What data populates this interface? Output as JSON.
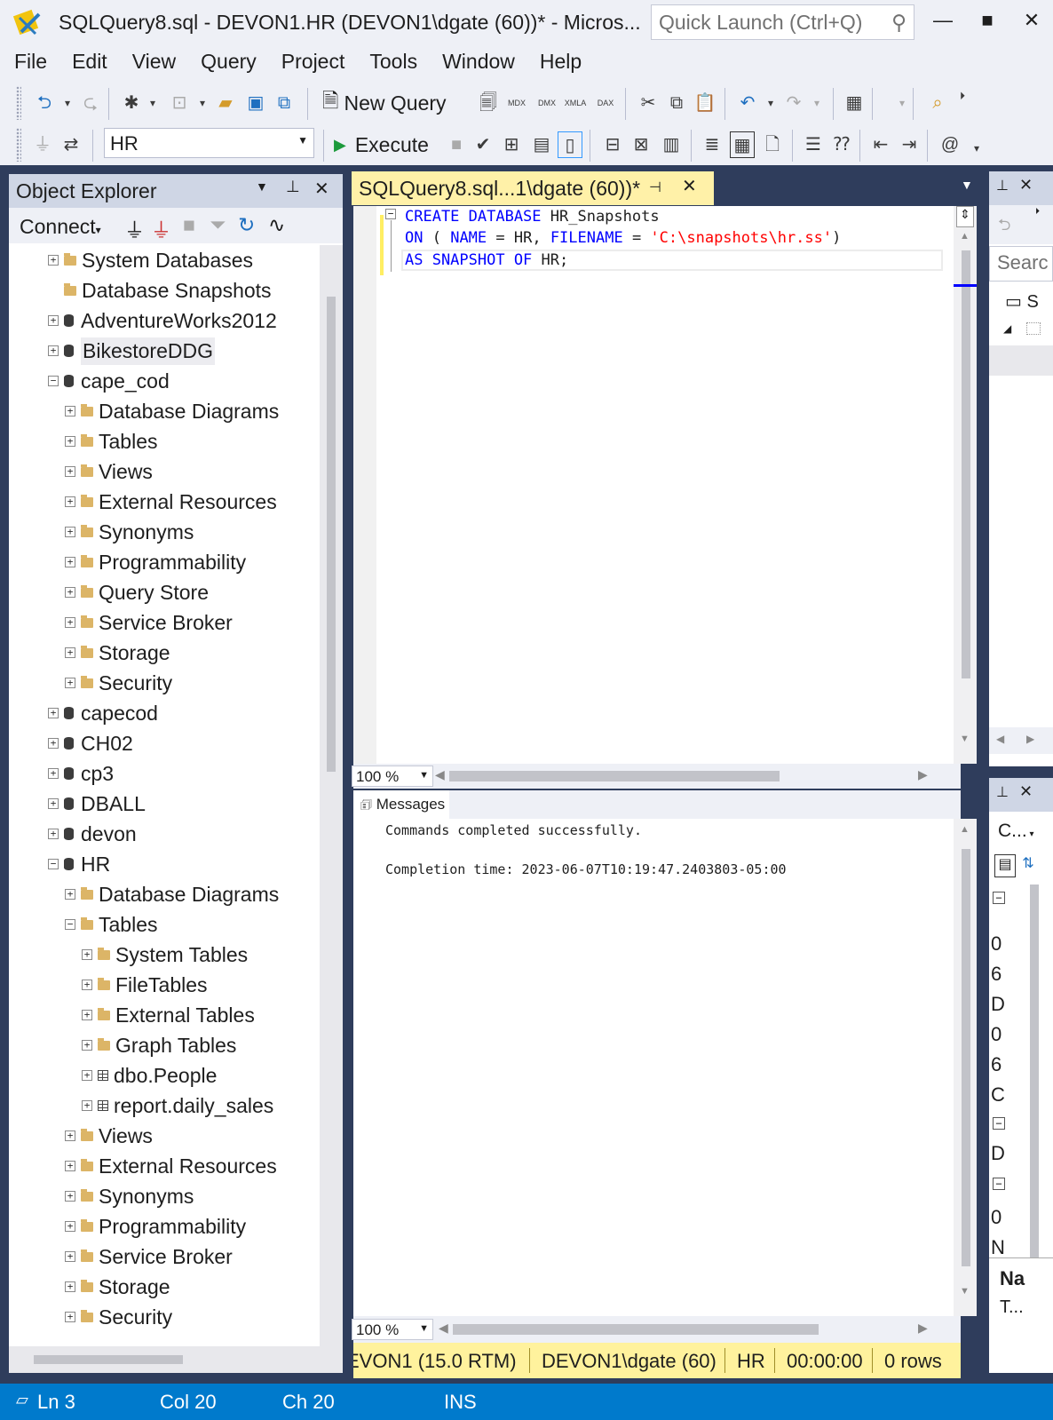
{
  "window": {
    "title": "SQLQuery8.sql - DEVON1.HR (DEVON1\\dgate (60))* - Micros...",
    "quick_launch_placeholder": "Quick Launch (Ctrl+Q)",
    "minimize": "—",
    "maximize": "■",
    "close": "✕"
  },
  "menu": [
    "File",
    "Edit",
    "View",
    "Query",
    "Project",
    "Tools",
    "Window",
    "Help"
  ],
  "toolbar": {
    "new_query": "New Query",
    "database": "HR",
    "execute": "Execute",
    "mdx": "MDX",
    "dmx": "DMX",
    "xmla": "XMLA",
    "dax": "DAX"
  },
  "object_explorer": {
    "title": "Object Explorer",
    "connect": "Connect",
    "tree": [
      {
        "label": "System Databases",
        "expander": "+",
        "icon": "folder-icon",
        "level": 0
      },
      {
        "label": "Database Snapshots",
        "expander": "",
        "icon": "folder-icon",
        "level": 0
      },
      {
        "label": "AdventureWorks2012",
        "expander": "+",
        "icon": "database-icon",
        "level": 0
      },
      {
        "label": "BikestoreDDG",
        "expander": "+",
        "icon": "database-icon",
        "level": 0,
        "hover": true
      },
      {
        "label": "cape_cod",
        "expander": "−",
        "icon": "database-icon",
        "level": 0
      },
      {
        "label": "Database Diagrams",
        "expander": "+",
        "icon": "folder-icon",
        "level": 1
      },
      {
        "label": "Tables",
        "expander": "+",
        "icon": "folder-icon",
        "level": 1
      },
      {
        "label": "Views",
        "expander": "+",
        "icon": "folder-icon",
        "level": 1
      },
      {
        "label": "External Resources",
        "expander": "+",
        "icon": "folder-icon",
        "level": 1
      },
      {
        "label": "Synonyms",
        "expander": "+",
        "icon": "folder-icon",
        "level": 1
      },
      {
        "label": "Programmability",
        "expander": "+",
        "icon": "folder-icon",
        "level": 1
      },
      {
        "label": "Query Store",
        "expander": "+",
        "icon": "folder-icon",
        "level": 1
      },
      {
        "label": "Service Broker",
        "expander": "+",
        "icon": "folder-icon",
        "level": 1
      },
      {
        "label": "Storage",
        "expander": "+",
        "icon": "folder-icon",
        "level": 1
      },
      {
        "label": "Security",
        "expander": "+",
        "icon": "folder-icon",
        "level": 1
      },
      {
        "label": "capecod",
        "expander": "+",
        "icon": "database-icon",
        "level": 0
      },
      {
        "label": "CH02",
        "expander": "+",
        "icon": "database-icon",
        "level": 0
      },
      {
        "label": "cp3",
        "expander": "+",
        "icon": "database-icon",
        "level": 0
      },
      {
        "label": "DBALL",
        "expander": "+",
        "icon": "database-icon",
        "level": 0
      },
      {
        "label": "devon",
        "expander": "+",
        "icon": "database-icon",
        "level": 0
      },
      {
        "label": "HR",
        "expander": "−",
        "icon": "database-icon",
        "level": 0
      },
      {
        "label": "Database Diagrams",
        "expander": "+",
        "icon": "folder-icon",
        "level": 1
      },
      {
        "label": "Tables",
        "expander": "−",
        "icon": "folder-icon",
        "level": 1
      },
      {
        "label": "System Tables",
        "expander": "+",
        "icon": "folder-icon",
        "level": 2
      },
      {
        "label": "FileTables",
        "expander": "+",
        "icon": "folder-icon",
        "level": 2
      },
      {
        "label": "External Tables",
        "expander": "+",
        "icon": "folder-icon",
        "level": 2
      },
      {
        "label": "Graph Tables",
        "expander": "+",
        "icon": "folder-icon",
        "level": 2
      },
      {
        "label": "dbo.People",
        "expander": "+",
        "icon": "table-icon",
        "level": 2
      },
      {
        "label": "report.daily_sales",
        "expander": "+",
        "icon": "table-icon",
        "level": 2
      },
      {
        "label": "Views",
        "expander": "+",
        "icon": "folder-icon",
        "level": 1
      },
      {
        "label": "External Resources",
        "expander": "+",
        "icon": "folder-icon",
        "level": 1
      },
      {
        "label": "Synonyms",
        "expander": "+",
        "icon": "folder-icon",
        "level": 1
      },
      {
        "label": "Programmability",
        "expander": "+",
        "icon": "folder-icon",
        "level": 1
      },
      {
        "label": "Service Broker",
        "expander": "+",
        "icon": "folder-icon",
        "level": 1
      },
      {
        "label": "Storage",
        "expander": "+",
        "icon": "folder-icon",
        "level": 1
      },
      {
        "label": "Security",
        "expander": "+",
        "icon": "folder-icon",
        "level": 1
      }
    ]
  },
  "editor": {
    "tab_title": "SQLQuery8.sql...1\\dgate (60))*",
    "line1": {
      "kw1": "CREATE DATABASE",
      "name": " HR_Snapshots"
    },
    "line2": {
      "kw1": "ON",
      "p1": " ( ",
      "kw2": "NAME",
      "p2": " = HR, ",
      "kw3": "FILENAME",
      "p3": " = ",
      "str": "'C:\\snapshots\\hr.ss'",
      "p4": ")"
    },
    "line3": {
      "kw1": "AS SNAPSHOT OF",
      "p1": " HR;"
    },
    "zoom": "100 %"
  },
  "results": {
    "tab": "Messages",
    "line1": "Commands completed successfully.",
    "line2": "Completion time: 2023-06-07T10:19:47.2403803-05:00",
    "zoom": "100 %"
  },
  "query_status": {
    "server": "EVON1 (15.0 RTM)",
    "user": "DEVON1\\dgate (60)",
    "db": "HR",
    "time": "00:00:00",
    "rows": "0 rows"
  },
  "right_panel": {
    "search": "Searc",
    "s_label": "S",
    "props_dropdown": "C...",
    "chars": [
      "0",
      "6",
      "D",
      "0",
      "6",
      "C"
    ],
    "d_label": "D",
    "chars2": [
      "0",
      "N"
    ],
    "name_label": "Na",
    "t_label": "T..."
  },
  "statusbar": {
    "ln": "Ln 3",
    "col": "Col 20",
    "ch": "Ch 20",
    "ins": "INS"
  }
}
